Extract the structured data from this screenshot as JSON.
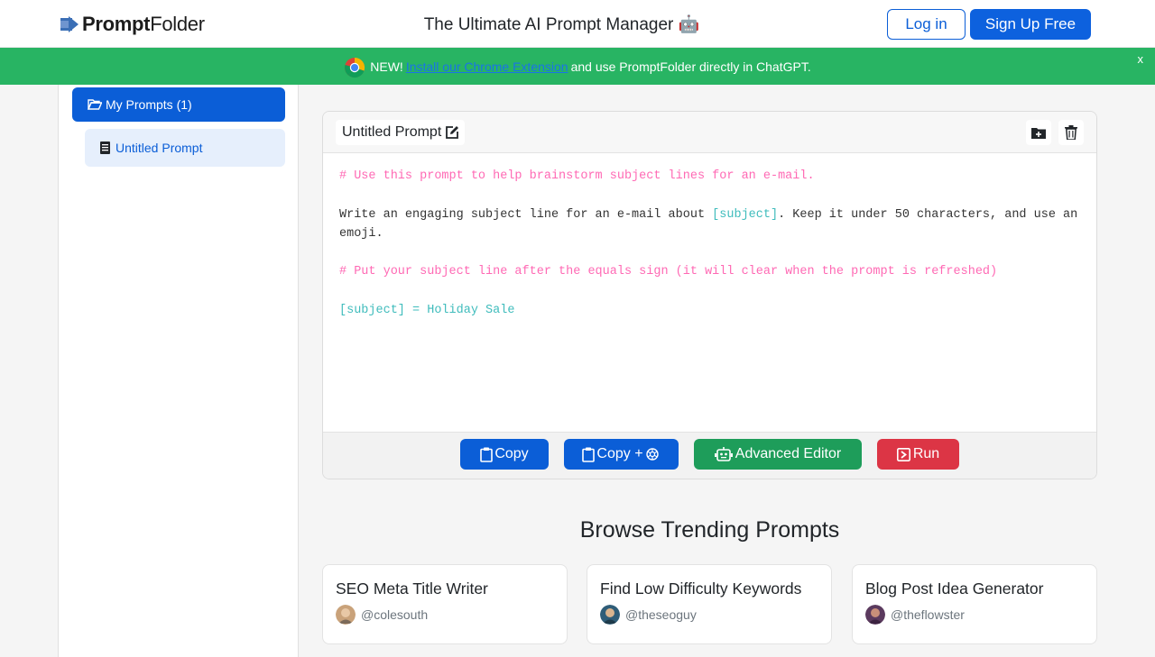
{
  "header": {
    "logo_bold": "Prompt",
    "logo_rest": "Folder",
    "tagline": "The Ultimate AI Prompt Manager 🤖",
    "login_label": "Log in",
    "signup_label": "Sign Up Free"
  },
  "banner": {
    "prefix": "NEW!",
    "link_text": "Install our Chrome Extension",
    "suffix": "and use PromptFolder directly in ChatGPT.",
    "close": "x"
  },
  "sidebar": {
    "folder_label": "My Prompts (1)",
    "items": [
      {
        "label": "Untitled Prompt"
      }
    ]
  },
  "editor": {
    "title": "Untitled Prompt",
    "lines": {
      "comment1": "# Use this prompt to help brainstorm subject lines for an e-mail.",
      "body_a": "Write an engaging subject line for an e-mail about ",
      "body_var": "[subject]",
      "body_b": ". Keep it under 50 characters, and use an emoji.",
      "comment2": "# Put your subject line after the equals sign (it will clear when the prompt is refreshed)",
      "assignment": "[subject] = Holiday Sale"
    },
    "actions": {
      "copy": "Copy",
      "copy_plus": "Copy +",
      "advanced": "Advanced Editor",
      "run": "Run"
    }
  },
  "trending": {
    "heading": "Browse Trending Prompts",
    "cards": [
      {
        "title": "SEO Meta Title Writer",
        "user": "@colesouth"
      },
      {
        "title": "Find Low Difficulty Keywords",
        "user": "@theseoguy"
      },
      {
        "title": "Blog Post Idea Generator",
        "user": "@theflowster"
      }
    ]
  },
  "colors": {
    "primary": "#0b5ed7",
    "success": "#1e9d5a",
    "danger": "#dc3545",
    "banner": "#28b463",
    "comment": "#ff69b4",
    "variable": "#3fbcbc"
  }
}
